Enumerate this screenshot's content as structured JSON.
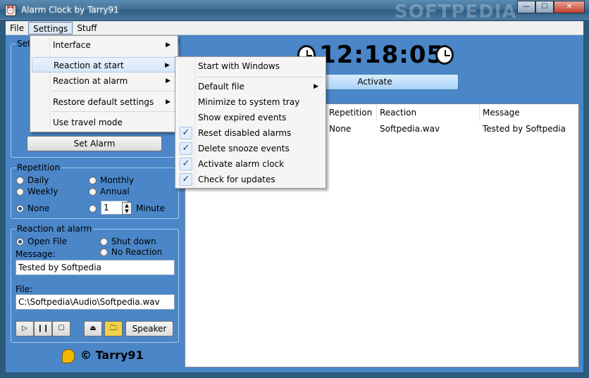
{
  "window": {
    "title": "Alarm Clock by Tarry91",
    "watermark": "SOFTPEDIA"
  },
  "menubar": [
    "File",
    "Settings",
    "Stuff"
  ],
  "settings_menu": {
    "items": [
      "Interface",
      "Reaction at start",
      "Reaction at alarm",
      "Restore default settings",
      "Use travel mode"
    ]
  },
  "reaction_at_start_menu": {
    "items": [
      {
        "label": "Start with Windows",
        "checked": false
      },
      {
        "label": "Default file",
        "checked": false
      },
      {
        "label": "Minimize to system tray",
        "checked": false
      },
      {
        "label": "Show expired events",
        "checked": false
      },
      {
        "label": "Reset disabled alarms",
        "checked": true
      },
      {
        "label": "Delete snooze events",
        "checked": true
      },
      {
        "label": "Activate alarm clock",
        "checked": true
      },
      {
        "label": "Check for updates",
        "checked": true
      }
    ]
  },
  "left_panel": {
    "set_group_label": "Set",
    "set_alarm_button": "Set Alarm",
    "repetition": {
      "label": "Repetition",
      "options": [
        "Daily",
        "Monthly",
        "Weekly",
        "Annual",
        "None"
      ],
      "selected": "None",
      "custom_value": "1",
      "custom_unit": "Minute"
    },
    "reaction": {
      "label": "Reaction at alarm",
      "options": [
        "Open File",
        "Shut down",
        "No Reaction"
      ],
      "selected": "Open File",
      "message_label": "Message:",
      "message_value": "Tested by Softpedia",
      "file_label": "File:",
      "file_value": "C:\\Softpedia\\Audio\\Softpedia.wav",
      "speaker_button": "Speaker"
    },
    "footer": "© Tarry91"
  },
  "right_panel": {
    "time": "12:18:05",
    "activate_button": "Activate",
    "table": {
      "columns": [
        "Repetition",
        "Reaction",
        "Message"
      ],
      "rows": [
        [
          "None",
          "Softpedia.wav",
          "Tested by Softpedia"
        ]
      ]
    }
  },
  "colors": {
    "client_bg": "#4a86c8",
    "accent": "#3c7fb1"
  }
}
